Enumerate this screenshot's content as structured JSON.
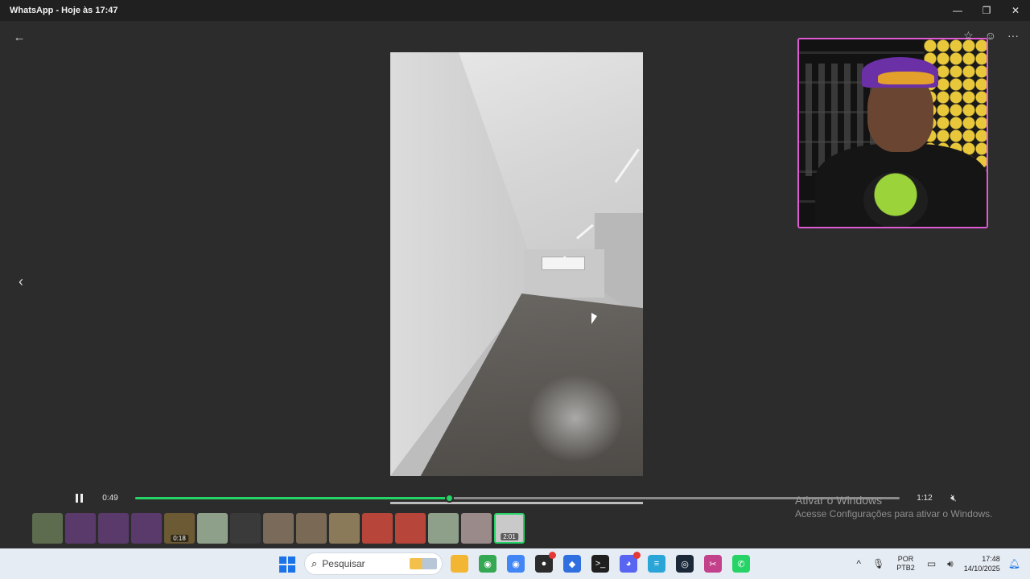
{
  "window": {
    "title": "WhatsApp - Hoje às 17:47",
    "minimize_glyph": "—",
    "maximize_glyph": "❐",
    "close_glyph": "✕"
  },
  "viewer": {
    "back_glyph": "←",
    "prev_glyph": "‹",
    "actions": [
      {
        "name": "star-icon",
        "glyph": "☆"
      },
      {
        "name": "react-icon",
        "glyph": "☺"
      },
      {
        "name": "more-icon",
        "glyph": "···"
      }
    ]
  },
  "player": {
    "current_time": "0:49",
    "duration": "1:12",
    "progress": 0.41,
    "pause_icon": "pause-icon",
    "mute_glyph": "🔇︎",
    "accent_color": "#25d366"
  },
  "thumbnails": [
    {
      "color": "#5d6b4e",
      "duration": ""
    },
    {
      "color": "#5a3a6b",
      "duration": ""
    },
    {
      "color": "#5a3a6b",
      "duration": ""
    },
    {
      "color": "#5a3a6b",
      "duration": ""
    },
    {
      "color": "#6b5a34",
      "duration": "0:18"
    },
    {
      "color": "#8fa08a",
      "duration": ""
    },
    {
      "color": "#3a3a3a",
      "duration": ""
    },
    {
      "color": "#7a6a5a",
      "duration": ""
    },
    {
      "color": "#7a6a55",
      "duration": ""
    },
    {
      "color": "#8a7a5a",
      "duration": ""
    },
    {
      "color": "#b8453a",
      "duration": ""
    },
    {
      "color": "#b8453a",
      "duration": ""
    },
    {
      "color": "#8fa08a",
      "duration": ""
    },
    {
      "color": "#9a8a8a",
      "duration": ""
    },
    {
      "color": "#c9c9c9",
      "duration": "2:01",
      "selected": true
    }
  ],
  "activation": {
    "line1": "Ativar o Windows",
    "line2": "Acesse Configurações para ativar o Windows."
  },
  "taskbar": {
    "search_placeholder": "Pesquisar",
    "search_glyph": "⌕",
    "apps": [
      {
        "name": "file-explorer-icon",
        "color": "#f2b632",
        "glyph": ""
      },
      {
        "name": "chrome-icon",
        "color": "#34a853",
        "glyph": "◉",
        "badge": false
      },
      {
        "name": "chrome-profile-icon",
        "color": "#4285f4",
        "glyph": "◉",
        "badge": false
      },
      {
        "name": "app-red-dot-icon",
        "color": "#2b2b2b",
        "glyph": "●",
        "badge": true
      },
      {
        "name": "diamond-app-icon",
        "color": "#2f6fe0",
        "glyph": "◆"
      },
      {
        "name": "terminal-icon",
        "color": "#1f1f1f",
        "glyph": ">_"
      },
      {
        "name": "discord-icon",
        "color": "#5865f2",
        "glyph": "◕",
        "badge": true
      },
      {
        "name": "notepad-icon",
        "color": "#2aa5d8",
        "glyph": "≡"
      },
      {
        "name": "steam-icon",
        "color": "#1b2838",
        "glyph": "◎"
      },
      {
        "name": "snipping-tool-icon",
        "color": "#c3418a",
        "glyph": "✂"
      },
      {
        "name": "whatsapp-icon",
        "color": "#25d366",
        "glyph": "✆"
      }
    ],
    "tray": {
      "chevron": "^",
      "mic": "🎙︎",
      "lang_line1": "POR",
      "lang_line2": "PTB2",
      "network": "▭",
      "volume": "🔊︎",
      "time": "17:48",
      "date": "14/10/2025",
      "bell": "🔔︎"
    }
  }
}
